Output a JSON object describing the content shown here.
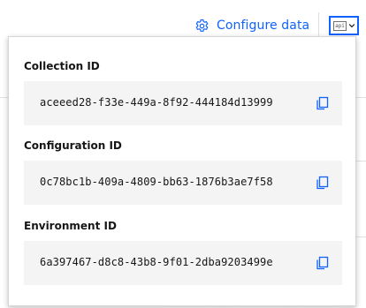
{
  "header": {
    "configure_label": "Configure data",
    "api_badge": "api",
    "accent_color": "#0f62fe"
  },
  "icons": {
    "configure": "gear-icon",
    "api": "api-icon",
    "dropdown": "chevron-down-icon",
    "copy": "copy-icon"
  },
  "fields": [
    {
      "label": "Collection ID",
      "value": "aceeed28-f33e-449a-8f92-444184d13999"
    },
    {
      "label": "Configuration ID",
      "value": "0c78bc1b-409a-4809-bb63-1876b3ae7f58"
    },
    {
      "label": "Environment ID",
      "value": "6a397467-d8c8-43b8-9f01-2dba9203499e"
    }
  ]
}
